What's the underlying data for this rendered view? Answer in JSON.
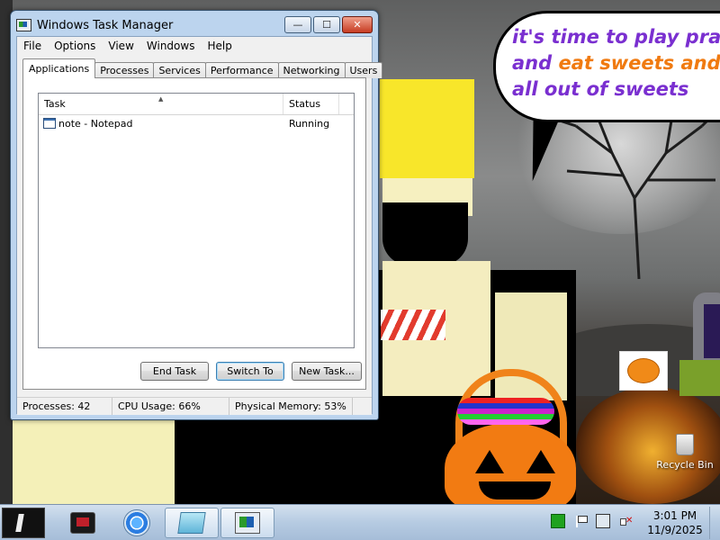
{
  "window": {
    "title": "Windows Task Manager",
    "controls": {
      "minimize": "—",
      "maximize": "☐",
      "close": "✕"
    }
  },
  "menu": [
    "File",
    "Options",
    "View",
    "Windows",
    "Help"
  ],
  "tabs": [
    {
      "label": "Applications",
      "active": true
    },
    {
      "label": "Processes",
      "active": false
    },
    {
      "label": "Services",
      "active": false
    },
    {
      "label": "Performance",
      "active": false
    },
    {
      "label": "Networking",
      "active": false
    },
    {
      "label": "Users",
      "active": false
    }
  ],
  "task_list": {
    "columns": {
      "task": "Task",
      "status": "Status"
    },
    "rows": [
      {
        "task": "note - Notepad",
        "status": "Running",
        "icon": "notepad-icon"
      }
    ]
  },
  "buttons": {
    "end_task": "End Task",
    "switch_to": "Switch To",
    "new_task": "New Task..."
  },
  "statusbar": {
    "processes": "Processes: 42",
    "cpu": "CPU Usage: 66%",
    "memory": "Physical Memory: 53%"
  },
  "desktop": {
    "speech_bubble": {
      "line1": "it's time to play pra",
      "line2_a": "and ",
      "line2_b": "eat sweets and i",
      "line3": "all out of sweets"
    },
    "icons": [
      {
        "label": "Recycle Bin",
        "icon": "recycle-bin-icon"
      }
    ]
  },
  "taskbar": {
    "apps": [
      {
        "name": "media-player-icon"
      },
      {
        "name": "browser-icon"
      },
      {
        "name": "notepad-icon",
        "active": true
      },
      {
        "name": "task-manager-icon"
      }
    ],
    "clock": {
      "time": "3:01 PM",
      "date": "11/9/2025"
    }
  },
  "colors": {
    "bubble_purple": "#7a2fd0",
    "bubble_orange": "#f07a10",
    "window_frame": "#bcd4ee",
    "close_red": "#c63b22"
  }
}
